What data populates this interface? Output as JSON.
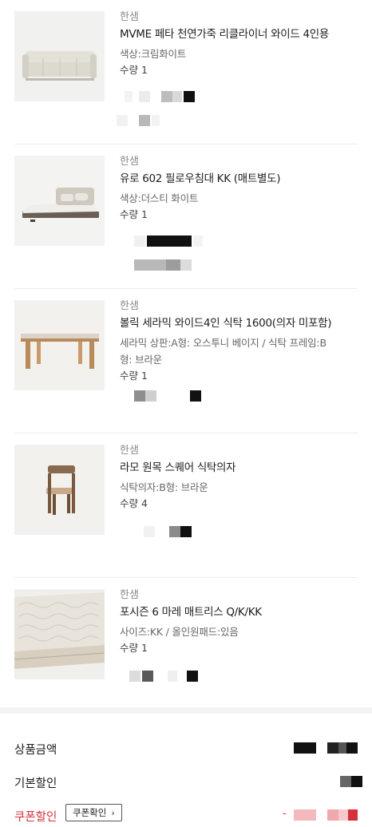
{
  "products": [
    {
      "brand": "한샘",
      "name": "MVME 페타 천연가죽 리클라이너 와이드 4인용",
      "option": "색상:크림화이트",
      "option2": "",
      "quantity": "수량 1",
      "image_icon": "sofa-image"
    },
    {
      "brand": "한샘",
      "name": "유로 602 필로우침대 KK (매트별도)",
      "option": "색상:더스티 화이트",
      "option2": "",
      "quantity": "수량 1",
      "image_icon": "bed-image"
    },
    {
      "brand": "한샘",
      "name": "볼릭 세라믹 와이드4인 식탁 1600(의자 미포함)",
      "option": "세라믹 상판:A형: 오스투니 베이지 / 식탁 프레임:B",
      "option2": "형: 브라운",
      "quantity": "수량 1",
      "image_icon": "table-image"
    },
    {
      "brand": "한샘",
      "name": "라모 원목 스퀘어 식탁의자",
      "option": "식탁의자:B형: 브라운",
      "option2": "",
      "quantity": "수량 4",
      "image_icon": "chair-image"
    },
    {
      "brand": "한샘",
      "name": "포시즌 6 마레 매트리스 Q/K/KK",
      "option": "사이즈:KK / 올인원패드:있음",
      "option2": "",
      "quantity": "수량 1",
      "image_icon": "mattress-image"
    }
  ],
  "summary": {
    "product_amount_label": "상품금액",
    "basic_discount_label": "기본할인",
    "coupon_discount_label": "쿠폰할인",
    "coupon_check_button": "쿠폰확인",
    "coupon_prefix": "-"
  },
  "colors": {
    "accent_red": "#d6313b",
    "divider": "#ececec",
    "brand_gray": "#8a8a8a"
  }
}
